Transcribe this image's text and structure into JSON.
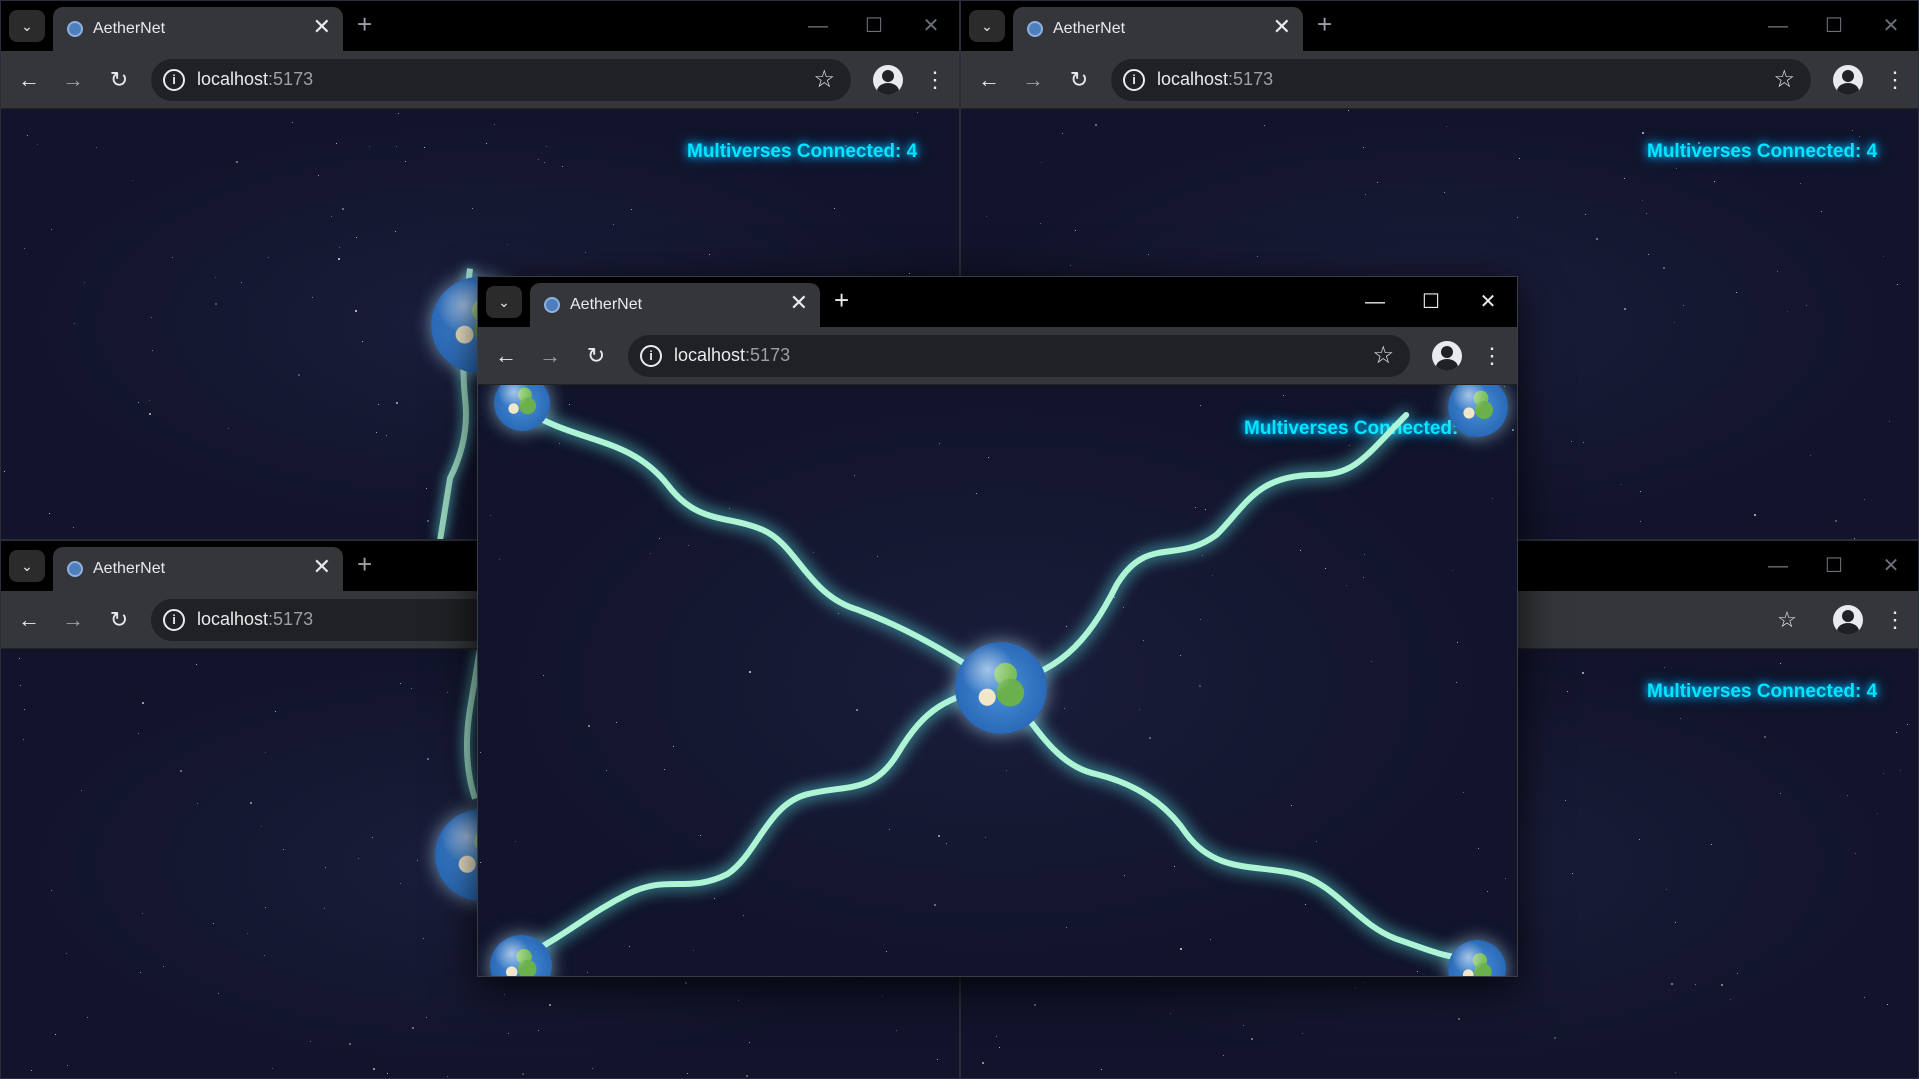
{
  "browser": {
    "tab_title": "AetherNet",
    "url_host": "localhost",
    "url_port": ":5173",
    "tab_close": "✕",
    "new_tab": "+",
    "minimize": "—",
    "maximize": "☐",
    "close": "✕"
  },
  "app": {
    "counter_text": "Multiverses Connected: 4"
  },
  "colors": {
    "accent": "#00e6ff",
    "link_glow": "#aef5d6",
    "space_bg": "#11142a"
  }
}
